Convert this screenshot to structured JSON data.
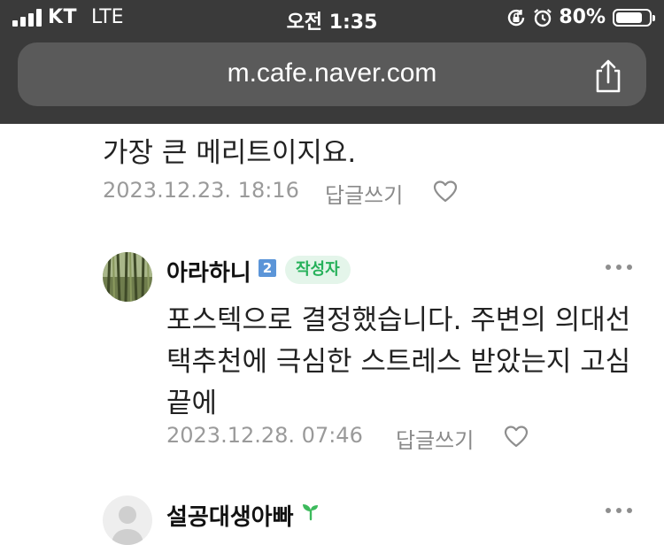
{
  "status_bar": {
    "carrier": "KT",
    "network": "LTE",
    "time": "오전 1:35",
    "battery_percent": "80%",
    "battery_level": 0.8,
    "icons": [
      "signal-icon",
      "orientation-lock-icon",
      "alarm-icon",
      "battery-icon"
    ]
  },
  "browser": {
    "url": "m.cafe.naver.com",
    "share_icon": "share-icon"
  },
  "comments": [
    {
      "text_lines": [
        "가장 큰 메리트이지요."
      ],
      "date": "2023.12.23. 18:16",
      "reply_label": "답글쓰기",
      "like_icon": "heart-icon"
    },
    {
      "author": "아라하니",
      "level_badge": "2",
      "author_badge": "작성자",
      "text_lines": [
        "포스텍으로 결정했습니다. 주변의 의대선",
        "택추천에 극심한 스트레스 받았는지 고심",
        "끝에"
      ],
      "date": "2023.12.28. 07:46",
      "reply_label": "답글쓰기",
      "like_icon": "heart-icon",
      "more_icon": "more-icon"
    },
    {
      "author": "설공대생아빠",
      "author_icon": "sprout-icon",
      "more_icon": "more-icon"
    }
  ],
  "colors": {
    "top_bar": "#3a3a3a",
    "url_field": "#5a5a5a",
    "author_badge_bg": "#e4f5ea",
    "author_badge_text": "#26b15a",
    "level_badge": "#5b95d8",
    "sprout": "#3cba5c"
  }
}
